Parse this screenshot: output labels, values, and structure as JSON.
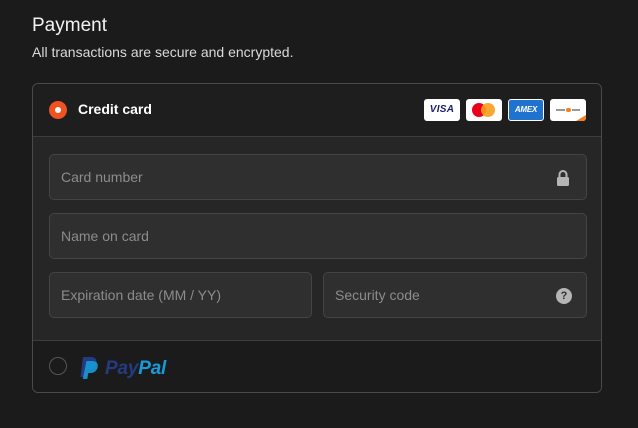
{
  "header": {
    "title": "Payment",
    "subtitle": "All transactions are secure and encrypted."
  },
  "payment_methods": {
    "credit_card": {
      "label": "Credit card",
      "selected": true,
      "radio_color": "#f05322",
      "card_brands": [
        {
          "name": "Visa",
          "text": "VISA",
          "icon": "visa-logo"
        },
        {
          "name": "Mastercard",
          "icon": "mastercard-logo"
        },
        {
          "name": "American Express",
          "text": "AMEX",
          "icon": "amex-logo"
        },
        {
          "name": "Discover",
          "icon": "discover-logo"
        }
      ],
      "fields": {
        "card_number": {
          "placeholder": "Card number",
          "value": "",
          "icon": "lock-icon"
        },
        "name_on_card": {
          "placeholder": "Name on card",
          "value": ""
        },
        "expiration": {
          "placeholder": "Expiration date (MM / YY)",
          "value": ""
        },
        "security_code": {
          "placeholder": "Security code",
          "value": "",
          "icon": "help-icon",
          "icon_glyph": "?"
        }
      }
    },
    "paypal": {
      "selected": false,
      "logo_pay": "Pay",
      "logo_pal": "Pal",
      "colors": {
        "pay": "#253b80",
        "pal": "#179bd7"
      }
    }
  }
}
